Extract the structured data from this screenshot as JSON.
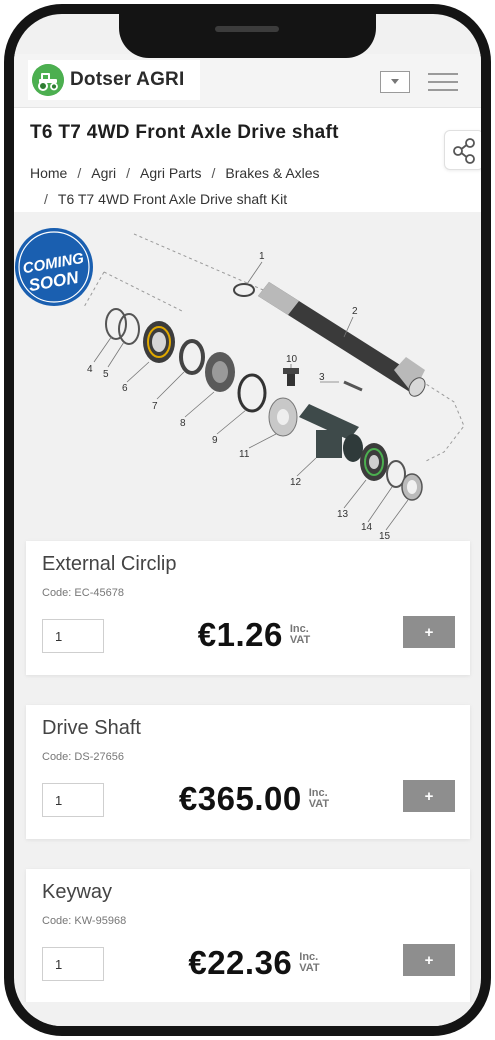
{
  "header": {
    "brand": "Dotser AGRI"
  },
  "page": {
    "title": "T6 T7 4WD Front Axle Drive shaft"
  },
  "breadcrumb": [
    "Home",
    "Agri",
    "Agri Parts",
    "Brakes & Axles",
    "T6 T7 4WD Front Axle Drive shaft Kit"
  ],
  "badge": {
    "line1": "COMING",
    "line2": "SOON"
  },
  "diagram": {
    "callouts": [
      "1",
      "2",
      "3",
      "4",
      "5",
      "6",
      "7",
      "8",
      "9",
      "10",
      "11",
      "12",
      "13",
      "14",
      "15"
    ]
  },
  "products": [
    {
      "name": "External Circlip",
      "code": "Code: EC-45678",
      "qty": "1",
      "price": "€1.26",
      "vat_line1": "Inc.",
      "vat_line2": "VAT",
      "add_label": "+"
    },
    {
      "name": "Drive Shaft",
      "code": "Code: DS-27656",
      "qty": "1",
      "price": "€365.00",
      "vat_line1": "Inc.",
      "vat_line2": "VAT",
      "add_label": "+"
    },
    {
      "name": "Keyway",
      "code": "Code: KW-95968",
      "qty": "1",
      "price": "€22.36",
      "vat_line1": "Inc.",
      "vat_line2": "VAT",
      "add_label": "+"
    }
  ],
  "colors": {
    "brand_green": "#4caf50",
    "badge_blue": "#1a5fb0",
    "button_grey": "#8e8e8e",
    "frame": "#141414"
  }
}
